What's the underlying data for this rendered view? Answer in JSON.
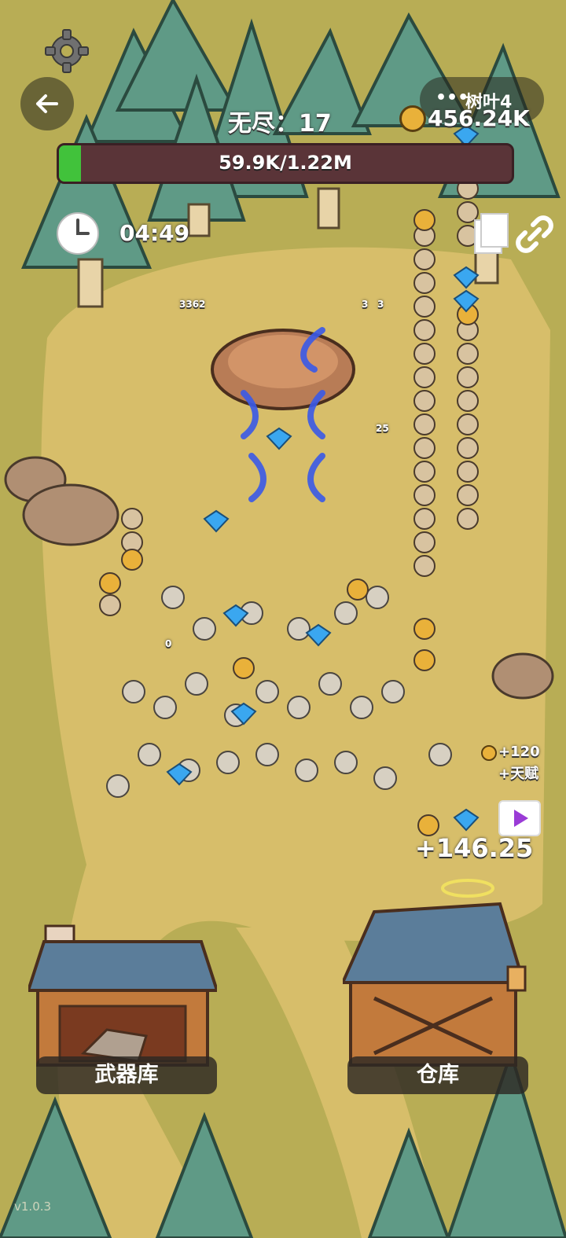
{
  "hud": {
    "endless_label": "无尽：17",
    "coins": "456.24K",
    "progress_text": "59.9K/1.22M",
    "progress_fraction": 0.049,
    "timer": "04:49",
    "resource_pill": "树叶4",
    "bonus_amount": "+120",
    "bonus_label": "+天赋",
    "floating_gain": "+146.25",
    "damage_numbers": [
      "3362",
      "3",
      "3",
      "0",
      "25"
    ]
  },
  "buildings": {
    "armory_label": "武器库",
    "warehouse_label": "仓库"
  },
  "version": "v1.0.3",
  "colors": {
    "grass": "#b8ad55",
    "path": "#d7be6a",
    "tree": "#5f9a86",
    "progress_bg": "#5a3438",
    "progress_fill": "#41c23b"
  },
  "icons": [
    "gear-icon",
    "back-arrow-icon",
    "clock-icon",
    "coin-icon",
    "copy-icon",
    "link-icon",
    "video-ad-icon"
  ]
}
